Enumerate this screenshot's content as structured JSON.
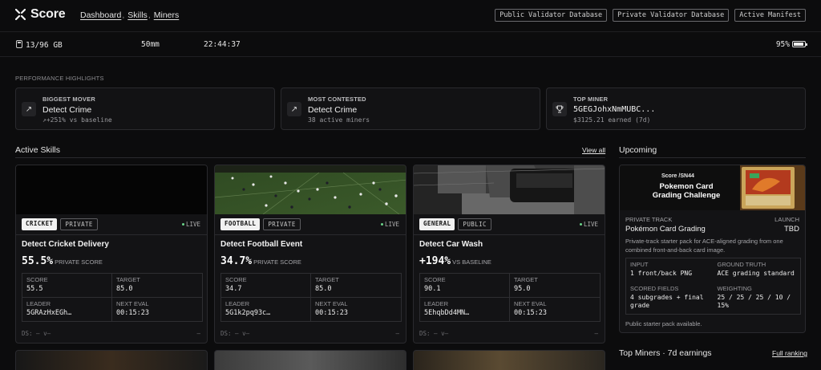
{
  "app": {
    "name": "Score",
    "nav": [
      {
        "label": "Dashboard",
        "sep": ","
      },
      {
        "label": "Skills",
        "sep": ","
      },
      {
        "label": "Miners",
        "sep": ""
      }
    ],
    "actions": [
      "Public Validator Database",
      "Private Validator Database",
      "Active Manifest"
    ]
  },
  "status": {
    "memory": "13/96 GB",
    "focal": "50mm",
    "clock": "22:44:37",
    "battery": "95%"
  },
  "highlights": {
    "section_label": "PERFORMANCE HIGHLIGHTS",
    "cards": [
      {
        "label": "BIGGEST MOVER",
        "value": "Detect Crime",
        "sub": "↗+251% vs baseline",
        "icon": "trend-up-icon",
        "glyph": "↗"
      },
      {
        "label": "MOST CONTESTED",
        "value": "Detect Crime",
        "sub": "38 active miners",
        "icon": "trend-up-icon",
        "glyph": "↗"
      },
      {
        "label": "TOP MINER",
        "value": "5GEGJohxNmMUBC...",
        "sub": "$3125.21 earned (7d)",
        "icon": "trophy-icon",
        "glyph": "♗"
      }
    ]
  },
  "skills": {
    "title": "Active Skills",
    "view_all": "View all",
    "cards": [
      {
        "category": "CRICKET",
        "visibility": "PRIVATE",
        "live": "LIVE",
        "name": "Detect Cricket Delivery",
        "metric": "55.5%",
        "metric_caption": "PRIVATE SCORE",
        "score_label": "SCORE",
        "score": "55.5",
        "target_label": "TARGET",
        "target": "85.0",
        "leader_label": "LEADER",
        "leader": "5GRAzHxEGh…",
        "next_label": "NEXT EVAL",
        "next_eval": "00:15:23",
        "footer": "DS: — v—",
        "footer_right": "—"
      },
      {
        "category": "FOOTBALL",
        "visibility": "PRIVATE",
        "live": "LIVE",
        "name": "Detect Football Event",
        "metric": "34.7%",
        "metric_caption": "PRIVATE SCORE",
        "score_label": "SCORE",
        "score": "34.7",
        "target_label": "TARGET",
        "target": "85.0",
        "leader_label": "LEADER",
        "leader": "5G1k2pq93c…",
        "next_label": "NEXT EVAL",
        "next_eval": "00:15:23",
        "footer": "DS: — v—",
        "footer_right": "—"
      },
      {
        "category": "GENERAL",
        "visibility": "PUBLIC",
        "live": "LIVE",
        "name": "Detect Car Wash",
        "metric": "+194%",
        "metric_caption": "VS BASELINE",
        "score_label": "SCORE",
        "score": "90.1",
        "target_label": "TARGET",
        "target": "95.0",
        "leader_label": "LEADER",
        "leader": "5EhqbDd4MN…",
        "next_label": "NEXT EVAL",
        "next_eval": "00:15:23",
        "footer": "DS: — v—",
        "footer_right": "—"
      }
    ]
  },
  "upcoming": {
    "title": "Upcoming",
    "banner_brand": "Score /SN44",
    "banner_title": "Pokemon Card Grading Challenge",
    "track_label": "PRIVATE TRACK",
    "launch_label": "LAUNCH",
    "name": "Pokémon Card Grading",
    "launch": "TBD",
    "description": "Private-track starter pack for ACE-aligned grading from one combined front-and-back card image.",
    "input_label": "INPUT",
    "input": "1 front/back PNG",
    "truth_label": "GROUND TRUTH",
    "truth": "ACE grading standard",
    "fields_label": "SCORED FIELDS",
    "fields": "4 subgrades + final grade",
    "weighting_label": "WEIGHTING",
    "weighting": "25 / 25 / 25 / 10 / 15%",
    "footer": "Public starter pack available."
  },
  "top_miners": {
    "title": "Top Miners · 7d earnings",
    "link": "Full ranking"
  }
}
